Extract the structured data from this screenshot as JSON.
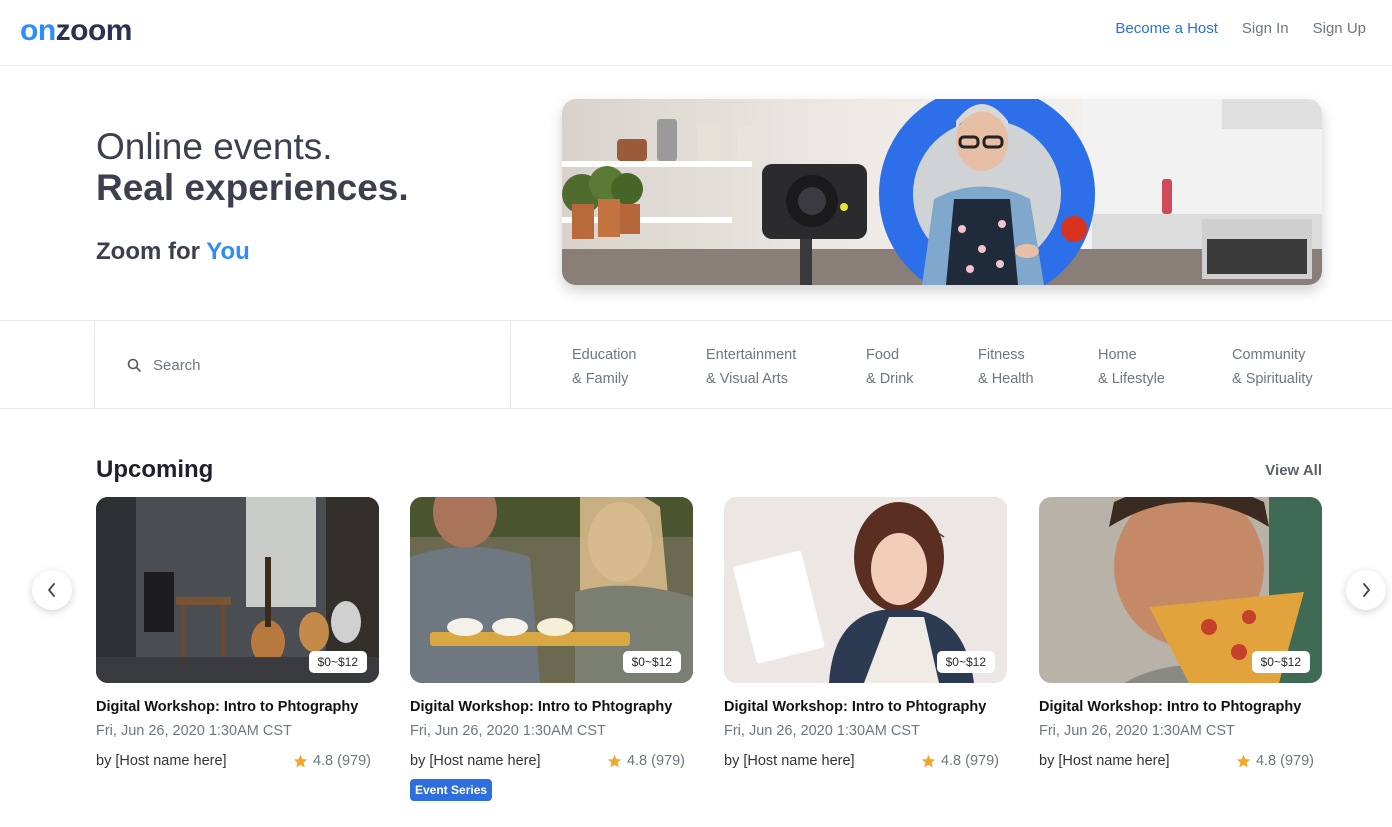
{
  "header": {
    "logo_on": "on",
    "logo_zoom": "zoom",
    "nav": {
      "become_host": "Become a Host",
      "sign_in": "Sign In",
      "sign_up": "Sign Up"
    }
  },
  "hero": {
    "line1": "Online events.",
    "line2": "Real experiences.",
    "sub_prefix": "Zoom for",
    "sub_accent": "You"
  },
  "search": {
    "placeholder": "Search"
  },
  "categories": [
    {
      "line1": "Education",
      "line2": "& Family"
    },
    {
      "line1": "Entertainment",
      "line2": "& Visual Arts"
    },
    {
      "line1": "Food",
      "line2": "& Drink"
    },
    {
      "line1": "Fitness",
      "line2": "& Health"
    },
    {
      "line1": "Home",
      "line2": "& Lifestyle"
    },
    {
      "line1": "Community",
      "line2": "& Spirituality"
    }
  ],
  "upcoming": {
    "title": "Upcoming",
    "view_all": "View All",
    "cards": [
      {
        "price": "$0~$12",
        "title": "Digital Workshop: Intro to Phtography",
        "date": "Fri, Jun 26, 2020 1:30AM CST",
        "host": "by [Host name here]",
        "rating": "4.8 (979)"
      },
      {
        "price": "$0~$12",
        "title": "Digital Workshop: Intro to Phtography",
        "date": "Fri, Jun 26, 2020 1:30AM CST",
        "host": "by [Host name here]",
        "rating": "4.8 (979)",
        "badge": "Event Series"
      },
      {
        "price": "$0~$12",
        "title": "Digital Workshop: Intro to Phtography",
        "date": "Fri, Jun 26, 2020 1:30AM CST",
        "host": "by [Host name here]",
        "rating": "4.8 (979)"
      },
      {
        "price": "$0~$12",
        "title": "Digital Workshop: Intro to Phtography",
        "date": "Fri, Jun 26, 2020 1:30AM CST",
        "host": "by [Host name here]",
        "rating": "4.8 (979)"
      }
    ]
  },
  "colors": {
    "brand_blue": "#2d8cff",
    "link_blue": "#2d6fdc",
    "star": "#f5a623"
  },
  "icons": [
    "search-icon",
    "chevron-left-icon",
    "chevron-right-icon",
    "star-icon"
  ]
}
